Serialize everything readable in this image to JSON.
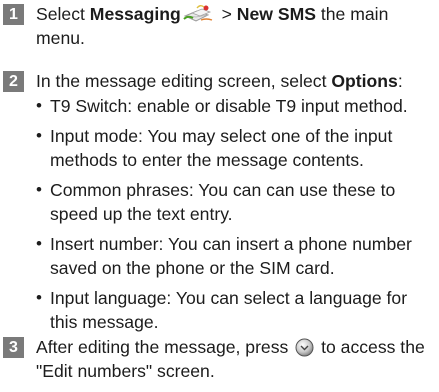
{
  "steps": [
    {
      "number": "1",
      "pre": "Select ",
      "bold1": "Messaging",
      "mid": " > ",
      "bold2": "New SMS",
      "post": " the main menu."
    },
    {
      "number": "2",
      "pre": "In the message editing screen, select ",
      "bold": "Options",
      "post": ":",
      "bullets": [
        "T9 Switch: enable or disable T9 input method.",
        "Input mode: You may select one of the input methods to enter the message contents.",
        "Common phrases: You can can use these to speed up the text entry.",
        "Insert number: You can insert a phone number saved on the phone or the SIM card.",
        "Input language: You can select a language for this message."
      ]
    },
    {
      "number": "3",
      "pre": "After editing the message, press",
      "post": "to access the \"Edit numbers\" screen."
    }
  ],
  "icons": {
    "messaging": "messaging-icon",
    "ok_key": "ok-key-icon"
  },
  "colors": {
    "step_badge": "#7a7a7a",
    "text": "#1c1c1c"
  }
}
